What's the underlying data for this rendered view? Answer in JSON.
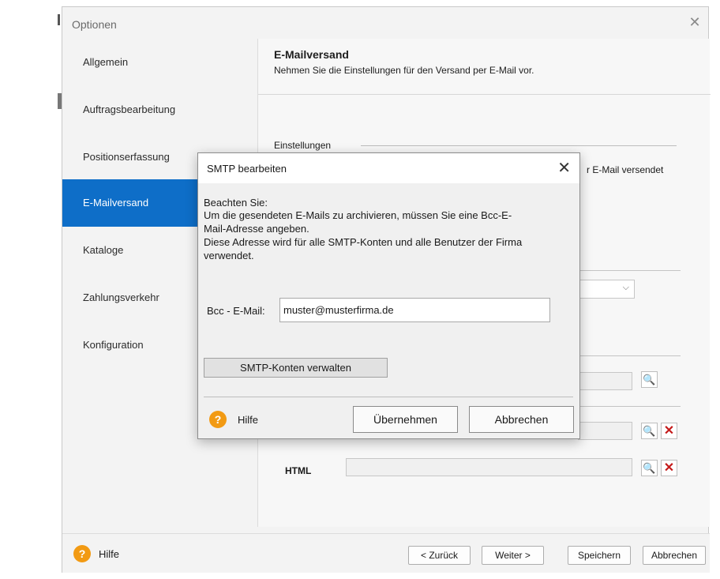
{
  "window": {
    "title": "Optionen",
    "close_glyph": "✕"
  },
  "sidebar": {
    "items": [
      {
        "label": "Allgemein"
      },
      {
        "label": "Auftragsbearbeitung"
      },
      {
        "label": "Positionserfassung"
      },
      {
        "label": "E-Mailversand",
        "active": true
      },
      {
        "label": "Kataloge"
      },
      {
        "label": "Zahlungsverkehr"
      },
      {
        "label": "Konfiguration"
      }
    ]
  },
  "content": {
    "title": "E-Mailversand",
    "subtitle": "Nehmen Sie die Einstellungen für den Versand per E-Mail vor.",
    "section_label": "Einstellungen",
    "partial_text": "r E-Mail versendet",
    "html_label": "HTML"
  },
  "footer": {
    "help_label": "Hilfe",
    "back_label": "< Zurück",
    "next_label": "Weiter >",
    "save_label": "Speichern",
    "cancel_label": "Abbrechen"
  },
  "dialog": {
    "title": "SMTP bearbeiten",
    "close_glyph": "✕",
    "note_lines": [
      "Beachten Sie:",
      "Um die gesendeten E-Mails zu archivieren, müssen Sie eine Bcc-E-",
      "Mail-Adresse angeben.",
      "Diese Adresse wird für alle SMTP-Konten und alle Benutzer der Firma",
      "verwendet."
    ],
    "bcc_label": "Bcc - E-Mail:",
    "bcc_value": "muster@musterfirma.de",
    "manage_button": "SMTP-Konten verwalten",
    "help_label": "Hilfe",
    "apply_label": "Übernehmen",
    "cancel_label": "Abbrechen"
  },
  "icons": {
    "help": "?",
    "search": "🔍",
    "delete": "✕",
    "chevron": "⌵"
  },
  "colors": {
    "accent": "#0e6ec8",
    "help_orange": "#f29a13",
    "delete_red": "#c41a1a"
  }
}
